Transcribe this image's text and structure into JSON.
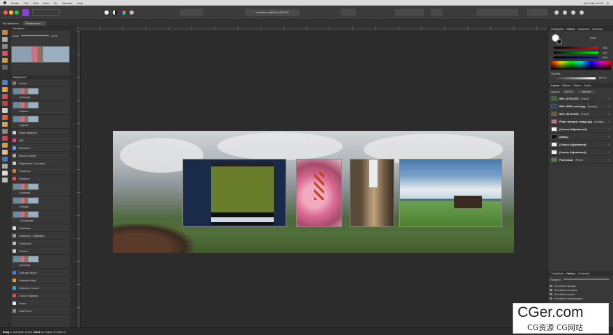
{
  "menubar": {
    "items": [
      "Finder",
      "File",
      "Edit",
      "View",
      "Go",
      "Window",
      "Help"
    ],
    "clock": "Sat 5 Mar 10:42"
  },
  "toolbar": {
    "document_title": "combined.afphoto (18.2%)"
  },
  "context": {
    "selection": "No Selection",
    "preferences": "Preferences..."
  },
  "navigator": {
    "title": "Navigator",
    "zoom_label": "Zoom",
    "zoom_value": "18 %"
  },
  "adjustment": {
    "title": "Adjustment",
    "items": [
      {
        "label": "Levels",
        "color": "#7a7a7a"
      },
      {
        "label": "(Default)",
        "preset": true
      },
      {
        "label": "Darken",
        "preset": true
      },
      {
        "label": "Lighten",
        "preset": true
      },
      {
        "label": "White Balance",
        "color": "#d0d0d0"
      },
      {
        "label": "HSL",
        "color": "#e04a7a"
      },
      {
        "label": "Recolour",
        "color": "#6aa0e0"
      },
      {
        "label": "Black & White",
        "color": "#aaaaaa"
      },
      {
        "label": "Brightness / Contrast",
        "color": "#cccccc"
      },
      {
        "label": "Posterise",
        "color": "#d08040"
      },
      {
        "label": "Vibrance",
        "color": "#e05a3a"
      },
      {
        "label": "(Default)",
        "preset": true
      },
      {
        "label": "Greyify",
        "preset": true
      },
      {
        "label": "Complicate",
        "preset": true
      },
      {
        "label": "Exposure",
        "color": "#dddddd"
      },
      {
        "label": "Shadows / Highlights",
        "color": "#999999"
      },
      {
        "label": "Threshold",
        "color": "#bbbbbb"
      },
      {
        "label": "Curves",
        "color": "#cccccc"
      },
      {
        "label": "(Default)",
        "preset": true
      },
      {
        "label": "Channel Mixer",
        "color": "#4a80d0"
      },
      {
        "label": "Gradient Map",
        "color": "#e0a040"
      },
      {
        "label": "Selective Colour",
        "color": "#40a0d0"
      },
      {
        "label": "Colour Balance",
        "color": "#d05050"
      },
      {
        "label": "Invert",
        "color": "#eeeeee"
      },
      {
        "label": "Soft Proof",
        "color": "#888888"
      }
    ]
  },
  "right_tabs": [
    "Histogram",
    "Colour",
    "Swatches",
    "Brushes"
  ],
  "colour": {
    "model": "RGB",
    "r": "255",
    "g": "255",
    "b": "255",
    "opacity_label": "Opacity",
    "opacity_value": "100 %"
  },
  "layer_tabs": [
    "Layers",
    "Effects",
    "Styles",
    "Stock"
  ],
  "layers_opacity": {
    "label": "Opacity",
    "value": "100 %",
    "blend": "Normal"
  },
  "layers": [
    {
      "name": "IMG_8733.CR2",
      "kind": "(Pixel)",
      "thumb": "#3a6a40"
    },
    {
      "name": "IMG_0006_work.jpg",
      "kind": "(Image)",
      "thumb": "#2a4a70"
    },
    {
      "name": "IMG_5471.CR2",
      "kind": "(Pixel)",
      "thumb": "#6a5a40"
    },
    {
      "name": "Final_merged_image.jpg",
      "kind": "(Image)",
      "thumb": "#c07090"
    },
    {
      "name": "(Curves Adjustment)",
      "kind": "",
      "thumb": "#eeeeee"
    },
    {
      "name": "(Mask)",
      "kind": "",
      "thumb": "#111111"
    },
    {
      "name": "(Colour Adjustment)",
      "kind": "",
      "thumb": "#eeeeee"
    },
    {
      "name": "(Levels Adjustment)",
      "kind": "",
      "thumb": "#eeeeee"
    },
    {
      "name": "Panorama",
      "kind": "(Pixel)",
      "thumb": "#5a7a50"
    }
  ],
  "history_tabs": [
    "Transform",
    "History",
    "Channels"
  ],
  "history": {
    "rotation_label": "Rotation",
    "items": [
      "Set effect opacity",
      "Set effect enabled",
      "Set effect radius",
      "Set effect compression"
    ]
  },
  "status": {
    "bold1": "Drag",
    "text1": "to marquee select.",
    "bold2": "Click",
    "text2": "an object to select it."
  },
  "watermark": {
    "title": "CGer.com",
    "subtitle": "CG资源 CG网站"
  }
}
